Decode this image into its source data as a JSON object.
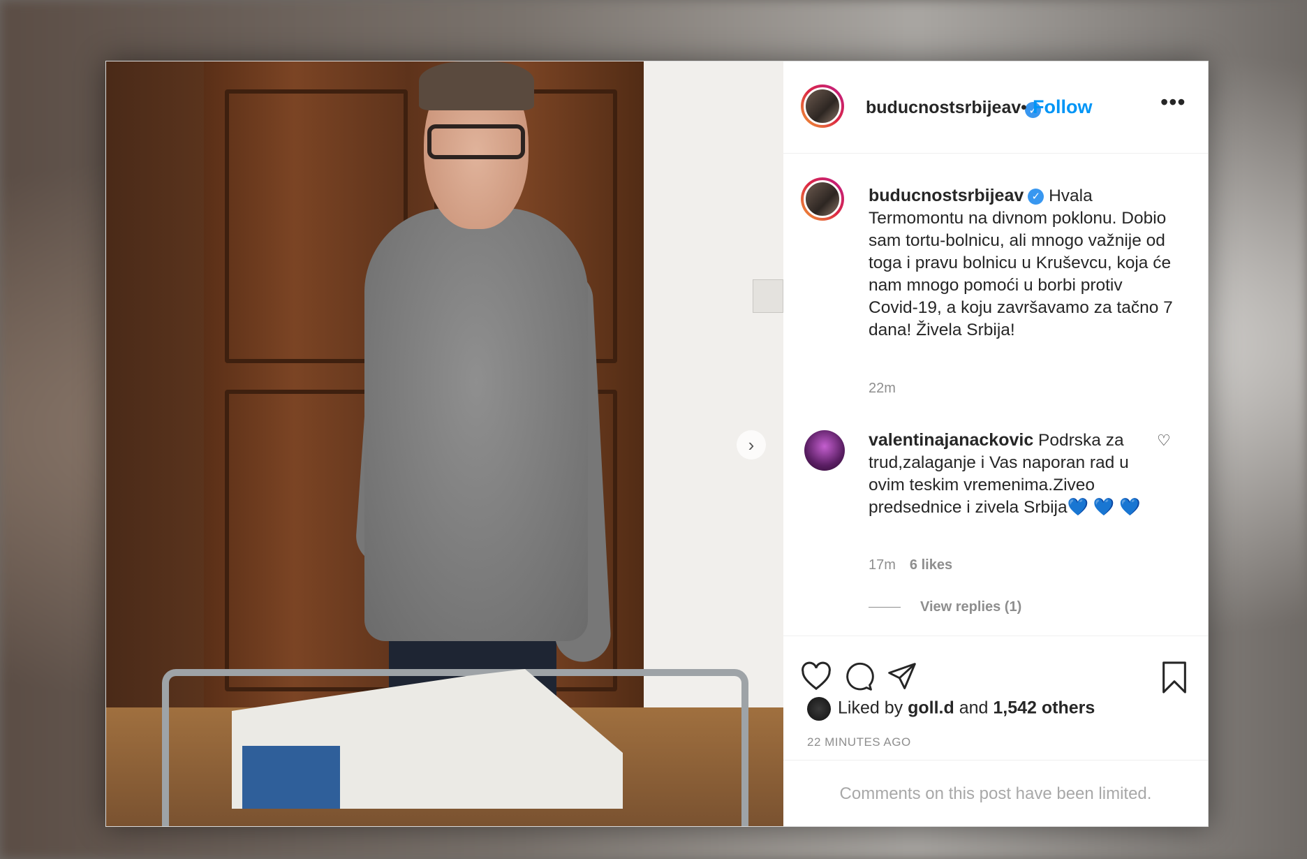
{
  "post": {
    "username": "buducnostsrbijeav",
    "follow_label": "Follow",
    "dot": "•",
    "more": "•••"
  },
  "caption": {
    "username": "buducnostsrbijeav",
    "text": "Hvala Termomontu na divnom poklonu. Dobio sam tortu-bolnicu, ali mnogo važnije od toga i pravu bolnicu u Kruševcu, koja će nam mnogo pomoći u borbi protiv Covid-19, a koju završavamo za tačno 7 dana! Živela Srbija!",
    "time": "22m"
  },
  "comment": {
    "username": "valentinajanackovic",
    "text": "Podrska za trud,zalaganje i Vas naporan rad u ovim teskim vremenima.Ziveo predsednice i zivela Srbija",
    "hearts": "💙 💙 💙",
    "time": "17m",
    "likes": "6 likes",
    "view_replies": "View replies (1)"
  },
  "likes": {
    "prefix": "Liked by",
    "user": "goll.d",
    "and": "and",
    "others": "1,542 others"
  },
  "timestamp": "22 MINUTES AGO",
  "comments_limited": "Comments on this post have been limited.",
  "photo_next": "›",
  "icons": {
    "verified": "✓",
    "comment_heart": "♡"
  }
}
